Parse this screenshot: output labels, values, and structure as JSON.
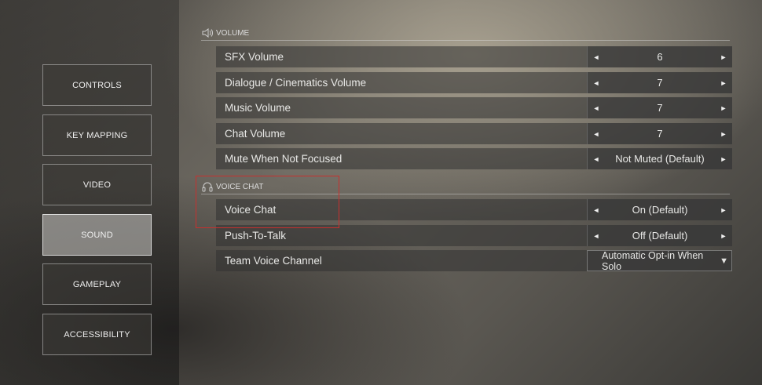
{
  "sidebar": {
    "items": [
      {
        "label": "CONTROLS"
      },
      {
        "label": "KEY MAPPING"
      },
      {
        "label": "VIDEO"
      },
      {
        "label": "SOUND"
      },
      {
        "label": "GAMEPLAY"
      },
      {
        "label": "ACCESSIBILITY"
      }
    ],
    "active": "SOUND"
  },
  "volume": {
    "header": "VOLUME",
    "icon": "speaker-icon",
    "rows": [
      {
        "label": "SFX Volume",
        "value": "6"
      },
      {
        "label": "Dialogue / Cinematics Volume",
        "value": "7"
      },
      {
        "label": "Music Volume",
        "value": "7"
      },
      {
        "label": "Chat Volume",
        "value": "7"
      },
      {
        "label": "Mute When Not Focused",
        "value": "Not Muted (Default)"
      }
    ]
  },
  "voice_chat": {
    "header": "VOICE CHAT",
    "icon": "headset-icon",
    "rows": [
      {
        "label": "Voice Chat",
        "value": "On (Default)"
      },
      {
        "label": "Push-To-Talk",
        "value": "Off (Default)"
      },
      {
        "label": "Team Voice Channel",
        "value": "Automatic Opt-in When Solo"
      }
    ]
  },
  "arrows": {
    "left": "◄",
    "right": "►",
    "dropdown": "▼"
  },
  "colors": {
    "highlight": "#c8302e"
  }
}
